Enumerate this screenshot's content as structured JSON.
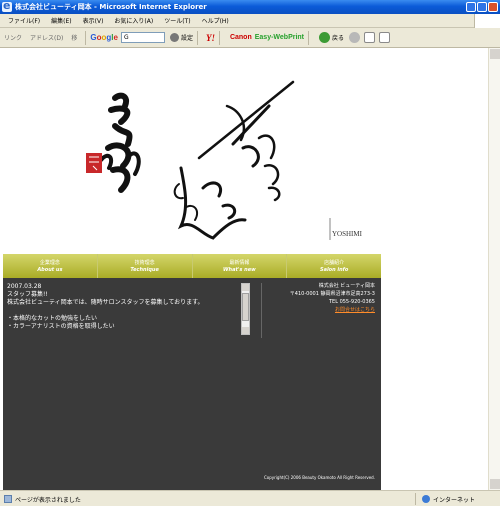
{
  "window": {
    "title": "株式会社ビューティ岡本 - Microsoft Internet Explorer"
  },
  "menubar": {
    "items": [
      "ファイル(F)",
      "編集(E)",
      "表示(V)",
      "お気に入り(A)",
      "ツール(T)",
      "ヘルプ(H)"
    ]
  },
  "toolbar": {
    "link_label": "リンク",
    "address_label": "アドレス(D)",
    "go_label": "移",
    "google_input": "G",
    "settings_label": "設定",
    "yahoo_label": "Y!",
    "canon_label": "Canon",
    "ewp_label": "Easy-WebPrint",
    "back_label": "戻る"
  },
  "site": {
    "nav": [
      {
        "jp": "企業理念",
        "en": "About us"
      },
      {
        "jp": "技術理念",
        "en": "Technique"
      },
      {
        "jp": "最新情報",
        "en": "What's new"
      },
      {
        "jp": "店舗紹介",
        "en": "Salon info"
      }
    ],
    "news": {
      "date": "2007.03.28",
      "heading": "スタッフ募集!!",
      "lines": [
        "株式会社ビューティ岡本では、随時サロンスタッフを募集しております。",
        "",
        "・本格的なカットの勉強をしたい",
        "・カラーアナリストの資格を取得したい"
      ]
    },
    "company": {
      "name": "株式会社 ビューティ岡本",
      "address": "〒410-0001 静岡県沼津市足高273-3",
      "tel": "TEL 055-920-0365",
      "contact_link": "お問合せはこちら"
    },
    "copyright": "Copyright(C) 2006 Beauty Okamoto All Right Reserved.",
    "brand": "YOSHIMI"
  },
  "statusbar": {
    "text": "ページが表示されました",
    "zone": "インターネット"
  },
  "colors": {
    "nav_top": "#d4d66a",
    "nav_bottom": "#a9ac26",
    "dark_panel": "#3a3a3a",
    "contact_link": "#ff8c2a"
  }
}
